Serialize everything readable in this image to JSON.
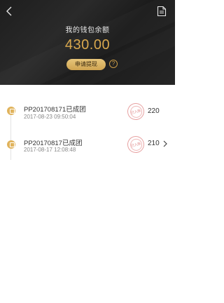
{
  "header": {
    "title": "我的钱包余额",
    "balance": "430.00",
    "withdraw_label": "申请提现",
    "help_symbol": "?"
  },
  "icons": {
    "back": "back-arrow-icon",
    "document": "document-icon",
    "help": "question-mark-icon",
    "chevron": "chevron-right-icon"
  },
  "colors": {
    "header_bg": "#222222",
    "accent_gold": "#d9a84e",
    "stamp_red": "#e08d8d"
  },
  "records": [
    {
      "title": "PP201708171已成团",
      "time": "2017-08-23 09:50:04",
      "amount": "220",
      "stamp": "已入账"
    },
    {
      "title": "PP20170817已成团",
      "time": "2017-08-17 12:08:48",
      "amount": "210",
      "stamp": "已入账"
    }
  ]
}
